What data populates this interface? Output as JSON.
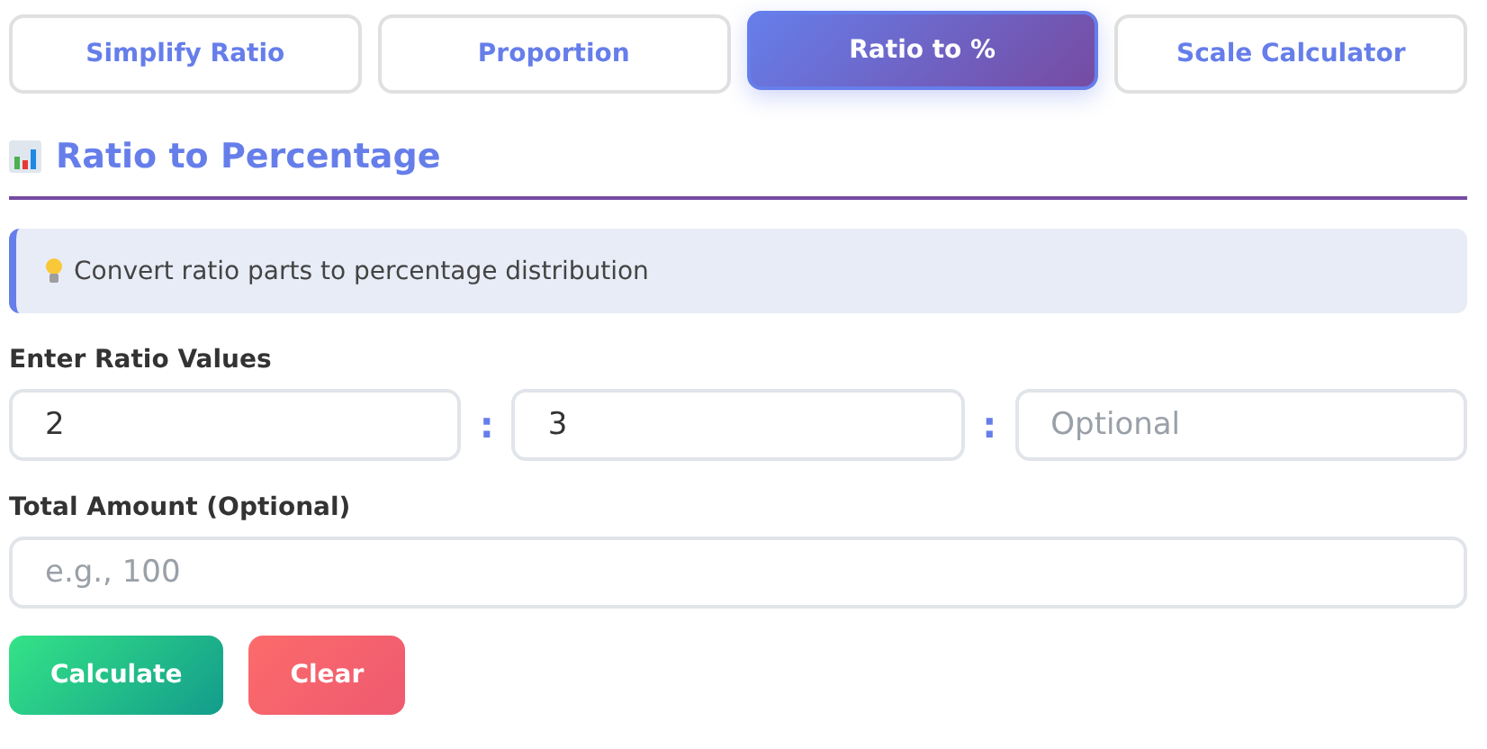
{
  "tabs": [
    {
      "label": "Simplify Ratio",
      "selected": false
    },
    {
      "label": "Proportion",
      "selected": false
    },
    {
      "label": "Ratio to %",
      "selected": true
    },
    {
      "label": "Scale Calculator",
      "selected": false
    }
  ],
  "section": {
    "title": "Ratio to Percentage"
  },
  "info": {
    "text": "Convert ratio parts to percentage distribution"
  },
  "ratio": {
    "label": "Enter Ratio Values",
    "separators": [
      ":",
      ":"
    ],
    "inputs": [
      {
        "value": "2"
      },
      {
        "value": "3"
      },
      {
        "placeholder": "Optional"
      }
    ]
  },
  "total": {
    "label": "Total Amount (Optional)",
    "placeholder": "e.g., 100"
  },
  "buttons": [
    {
      "label": "Calculate",
      "kind": "primary"
    },
    {
      "label": "Clear",
      "kind": "danger"
    }
  ]
}
